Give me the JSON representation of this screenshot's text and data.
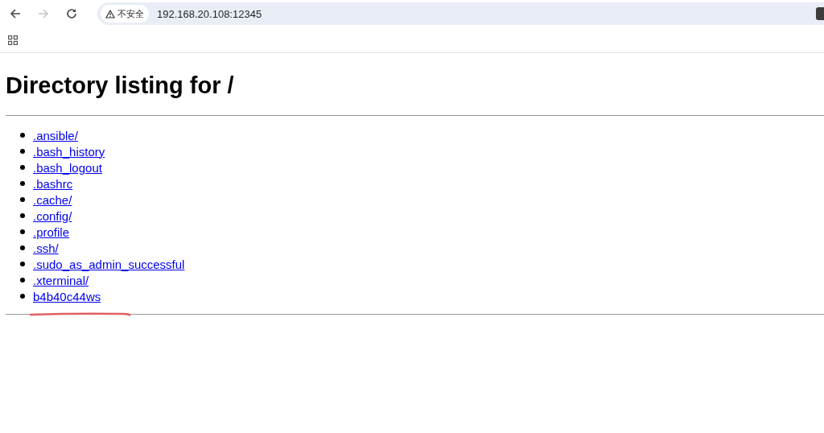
{
  "browser": {
    "back_disabled": false,
    "forward_disabled": true,
    "security_label": "不安全",
    "url": "192.168.20.108:12345"
  },
  "page": {
    "heading": "Directory listing for /",
    "entries": [
      {
        "name": ".ansible/"
      },
      {
        "name": ".bash_history"
      },
      {
        "name": ".bash_logout"
      },
      {
        "name": ".bashrc"
      },
      {
        "name": ".cache/"
      },
      {
        "name": ".config/"
      },
      {
        "name": ".profile"
      },
      {
        "name": ".ssh/"
      },
      {
        "name": ".sudo_as_admin_successful"
      },
      {
        "name": ".xterminal/"
      },
      {
        "name": "b4b40c44ws"
      }
    ]
  }
}
